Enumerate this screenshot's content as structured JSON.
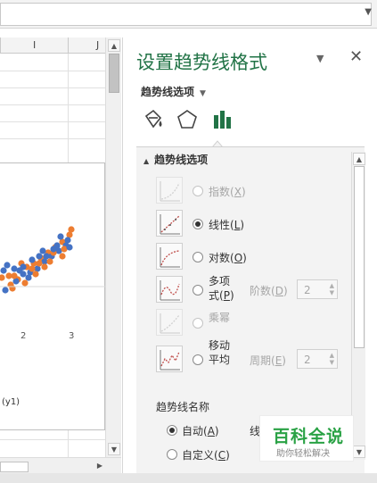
{
  "pane": {
    "title": "设置趋势线格式",
    "section_dropdown": "趋势线选项",
    "close": "✕",
    "dropdown_arrow": "▼"
  },
  "sheet": {
    "columns": [
      "I",
      "J"
    ],
    "axis_ticks": [
      "2",
      "3"
    ],
    "series_label": "(y1)"
  },
  "options": {
    "section_title": "趋势线选项",
    "types": [
      {
        "label": "指数",
        "key": "X",
        "enabled": false,
        "checked": false
      },
      {
        "label": "线性",
        "key": "L",
        "enabled": true,
        "checked": true
      },
      {
        "label": "对数",
        "key": "O",
        "enabled": true,
        "checked": false
      },
      {
        "label": "多项式",
        "key": "P",
        "enabled": true,
        "checked": false
      },
      {
        "label": "乘幂",
        "key": "W",
        "enabled": false,
        "checked": false
      },
      {
        "label": "移动平均",
        "key": "M",
        "enabled": true,
        "checked": false
      }
    ],
    "poly_order": {
      "label": "阶数",
      "key": "D",
      "value": "2"
    },
    "moving_period": {
      "label": "周期",
      "key": "E",
      "value": "2"
    },
    "name_header": "趋势线名称",
    "name_auto": {
      "label": "自动",
      "key": "A",
      "checked": true
    },
    "name_custom": {
      "label": "自定义",
      "key": "C",
      "checked": false
    },
    "name_auto_value_prefix": "线"
  },
  "watermark": {
    "brand": "百科全说",
    "sub": "助你轻松解决"
  },
  "colors": {
    "accent": "#217346",
    "series_blue": "#4472c4",
    "series_orange": "#ed7d31"
  }
}
